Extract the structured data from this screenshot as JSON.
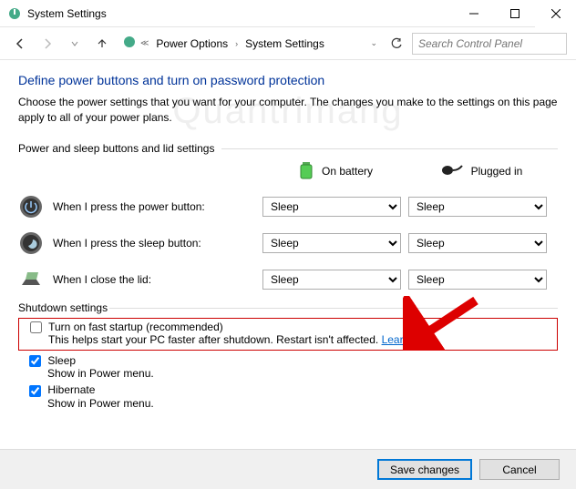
{
  "window": {
    "title": "System Settings"
  },
  "breadcrumb": {
    "item1": "Power Options",
    "item2": "System Settings"
  },
  "search": {
    "placeholder": "Search Control Panel"
  },
  "heading": "Define power buttons and turn on password protection",
  "description": "Choose the power settings that you want for your computer. The changes you make to the settings on this page apply to all of your power plans.",
  "section1": "Power and sleep buttons and lid settings",
  "columns": {
    "battery": "On battery",
    "plugged": "Plugged in"
  },
  "rows": {
    "power": {
      "label": "When I press the power button:",
      "battery": "Sleep",
      "plugged": "Sleep"
    },
    "sleep": {
      "label": "When I press the sleep button:",
      "battery": "Sleep",
      "plugged": "Sleep"
    },
    "lid": {
      "label": "When I close the lid:",
      "battery": "Sleep",
      "plugged": "Sleep"
    }
  },
  "section2": "Shutdown settings",
  "shutdown": {
    "fast": {
      "label": "Turn on fast startup (recommended)",
      "sub": "This helps start your PC faster after shutdown. Restart isn't affected.",
      "link": "Learn More",
      "checked": false
    },
    "sleep": {
      "label": "Sleep",
      "sub": "Show in Power menu.",
      "checked": true
    },
    "hibernate": {
      "label": "Hibernate",
      "sub": "Show in Power menu.",
      "checked": true
    }
  },
  "buttons": {
    "save": "Save changes",
    "cancel": "Cancel"
  },
  "watermark": "Quantrimang"
}
